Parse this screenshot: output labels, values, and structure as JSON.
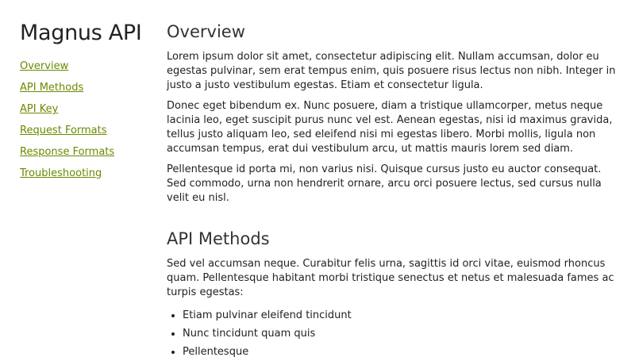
{
  "sidebar": {
    "title": "Magnus API",
    "items": [
      {
        "label": "Overview"
      },
      {
        "label": "API Methods"
      },
      {
        "label": "API Key"
      },
      {
        "label": "Request Formats"
      },
      {
        "label": "Response Formats"
      },
      {
        "label": "Troubleshooting"
      }
    ]
  },
  "main": {
    "sections": [
      {
        "title": "Overview",
        "paragraphs": [
          "Lorem ipsum dolor sit amet, consectetur adipiscing elit. Nullam accumsan, dolor eu egestas pulvinar, sem erat tempus enim, quis posuere risus lectus non nibh. Integer in justo a justo vestibulum egestas. Etiam et consectetur ligula.",
          "Donec eget bibendum ex. Nunc posuere, diam a tristique ullamcorper, metus neque lacinia leo, eget suscipit purus nunc vel est. Aenean egestas, nisi id maximus gravida, tellus justo aliquam leo, sed eleifend nisi mi egestas libero. Morbi mollis, ligula non accumsan tempus, erat dui vestibulum arcu, ut mattis mauris lorem sed diam.",
          "Pellentesque id porta mi, non varius nisi. Quisque cursus justo eu auctor consequat. Sed commodo, urna non hendrerit ornare, arcu orci posuere lectus, sed cursus nulla velit eu nisl."
        ]
      },
      {
        "title": "API Methods",
        "paragraphs": [
          "Sed vel accumsan neque. Curabitur felis urna, sagittis id orci vitae, euismod rhoncus quam. Pellentesque habitant morbi tristique senectus et netus et malesuada fames ac turpis egestas:"
        ],
        "bullets": [
          "Etiam pulvinar eleifend tincidunt",
          "Nunc tincidunt quam quis",
          "Pellentesque"
        ]
      }
    ]
  },
  "colors": {
    "link": "#6a8a00",
    "text": "#222222",
    "background": "#ffffff"
  }
}
